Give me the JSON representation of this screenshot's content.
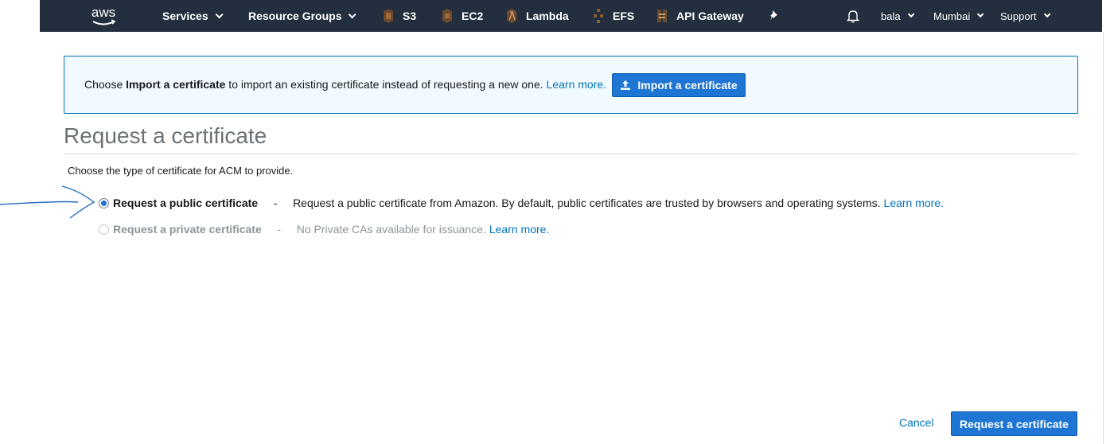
{
  "nav": {
    "logo": "aws",
    "services": "Services",
    "resource_groups": "Resource Groups",
    "shortcuts": [
      {
        "label": "S3",
        "icon": "s3-icon",
        "color": "#8c4f1f"
      },
      {
        "label": "EC2",
        "icon": "ec2-icon",
        "color": "#8c4f1f"
      },
      {
        "label": "Lambda",
        "icon": "lambda-icon",
        "color": "#8c4f1f"
      },
      {
        "label": "EFS",
        "icon": "efs-icon",
        "color": "#8c4f1f"
      },
      {
        "label": "API Gateway",
        "icon": "api-gateway-icon",
        "color": "#8c4f1f"
      }
    ],
    "user": "bala",
    "region": "Mumbai",
    "support": "Support"
  },
  "banner": {
    "prefix": "Choose ",
    "bold": "Import a certificate",
    "suffix": " to import an existing certificate instead of requesting a new one. ",
    "learn_more": "Learn more.",
    "button_label": "Import a certificate"
  },
  "page": {
    "title": "Request a certificate",
    "subtitle": "Choose the type of certificate for ACM to provide."
  },
  "options": [
    {
      "label": "Request a public certificate",
      "separator": "-",
      "description": "Request a public certificate from Amazon. By default, public certificates are trusted by browsers and operating systems. ",
      "learn_more": "Learn more.",
      "selected": true,
      "disabled": false
    },
    {
      "label": "Request a private certificate",
      "separator": "-",
      "description": "No Private CAs available for issuance. ",
      "learn_more": "Learn more.",
      "selected": false,
      "disabled": true
    }
  ],
  "footer": {
    "cancel": "Cancel",
    "submit": "Request a certificate"
  },
  "colors": {
    "nav_bg": "#232f3e",
    "primary": "#1e75d4",
    "link": "#0073bb",
    "banner_bg": "#f1faff",
    "arrow_ink": "#2a6cc4"
  }
}
